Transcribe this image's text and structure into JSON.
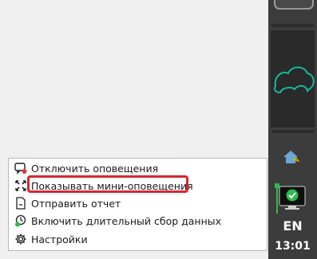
{
  "menu": {
    "items": [
      {
        "label": "Отключить оповещения",
        "icon": "notifications-off-icon"
      },
      {
        "label": "Показывать мини-оповещения",
        "icon": "mini-notifications-icon"
      },
      {
        "label": "Отправить отчет",
        "icon": "report-document-icon"
      },
      {
        "label": "Включить длительный сбор данных",
        "icon": "data-collection-icon"
      },
      {
        "label": "Настройки",
        "icon": "gear-icon"
      }
    ]
  },
  "taskbar": {
    "language": "EN",
    "time": "13:01"
  },
  "colors": {
    "highlight_border": "#d6262f",
    "dock_background": "#3c3c3c",
    "accent_green": "#2bbd4a"
  }
}
